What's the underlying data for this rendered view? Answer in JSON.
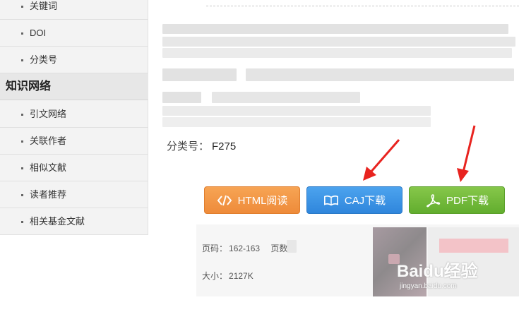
{
  "sidebar": {
    "items_top": [
      {
        "label": "关键词"
      },
      {
        "label": "DOI"
      },
      {
        "label": "分类号"
      }
    ],
    "section_title": "知识网络",
    "items_network": [
      {
        "label": "引文网络"
      },
      {
        "label": "关联作者"
      },
      {
        "label": "相似文献"
      },
      {
        "label": "读者推荐"
      },
      {
        "label": "相关基金文献"
      }
    ]
  },
  "main": {
    "class_label": "分类号：",
    "class_value": "F275"
  },
  "buttons": {
    "html_read": "HTML阅读",
    "caj_download": "CAJ下载",
    "pdf_download": "PDF下载"
  },
  "info": {
    "pages_label": "页码：",
    "pages_value": "162-163",
    "page_count_label": "页数",
    "size_label": "大小：",
    "size_value": "2127K"
  },
  "watermark": {
    "brand": "Baidu经验",
    "url": "jingyan.baidu.com"
  },
  "colors": {
    "html_button": "#f09444",
    "caj_button": "#3b92e4",
    "pdf_button": "#6fb83a",
    "arrow": "#e8231f"
  }
}
